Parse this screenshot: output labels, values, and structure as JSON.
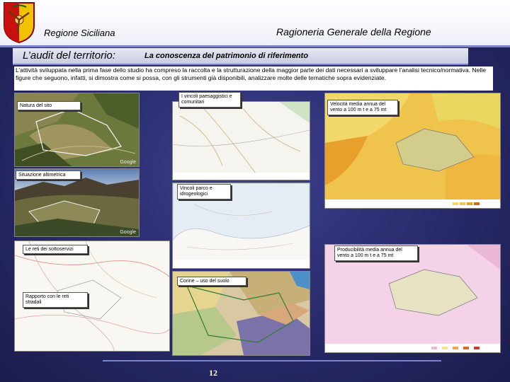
{
  "header": {
    "left_title": "Regione Siciliana",
    "right_title": "Ragioneria Generale della Regione"
  },
  "section": {
    "title_main": "L’audit del territorio:",
    "title_sub": "La conoscenza del patrimonio di riferimento"
  },
  "intro_text": "L’attività sviluppata nella prima fase dello studio ha compreso la raccolta e la strutturazione della maggior parte dei dati necessari a sviluppare l’analisi tecnico/normativa. Nelle figure che seguono, infatti, si dimostra come si possa, con gli strumenti già disponibili, analizzare molte delle tematiche sopra evidenziate.",
  "labels": {
    "natura": "Natura del sito",
    "vincoli_paesaggistici": "I vincoli paesaggistici e comunitari",
    "vento_velocita": "Velocità media annua del vento a 100 m t e a 75 mt",
    "altimetrica": "Situazione altimetrica",
    "vincoli_idrogeologici": "Vincoli parco e idrogeologici",
    "reti_sottoservizi": "Le reti dei sottoservizi",
    "producibilita": "Producibilità media annua del vento a 100 m t e a 75 mt",
    "corine": "Corine – uso del suolo",
    "reti_stradali": "Rapporto con le reti stradali"
  },
  "watermark": "Google",
  "page_number": "12",
  "colors": {
    "background": "#282a6a",
    "header_bar": "#ffffff",
    "title_bar": "#dde0ec",
    "accent_line": "#7c83c8"
  },
  "icons": {
    "emblem": "sicily-trinacria-emblem"
  }
}
